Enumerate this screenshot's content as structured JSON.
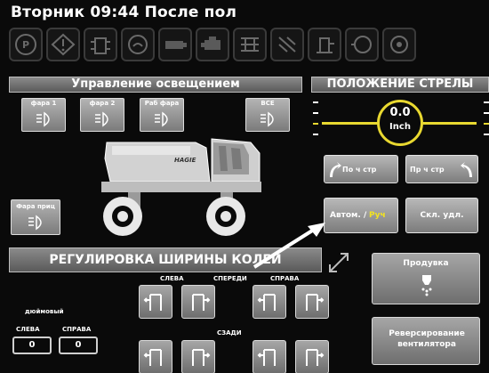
{
  "header": {
    "title": "Вторник 09:44 После пол"
  },
  "warning_icons": [
    "parking-brake-icon",
    "warning-triangle-icon",
    "fuel-filter-icon",
    "coolant-icon",
    "oil-pressure-icon",
    "engine-icon",
    "transmission-icon",
    "hydraulic-icon",
    "oil-level-icon",
    "engine-check-icon",
    "filter-icon"
  ],
  "lighting": {
    "title": "Управление освещением",
    "buttons": [
      {
        "label": "фара 1"
      },
      {
        "label": "фара 2"
      },
      {
        "label": "Раб фара"
      },
      {
        "label": "ВСЕ"
      },
      {
        "label": "Фара приц"
      }
    ],
    "vehicle_brand": "HAGIE"
  },
  "boom": {
    "title": "ПОЛОЖЕНИЕ СТРЕЛЫ",
    "value": "0.0",
    "unit": "Inch",
    "buttons": {
      "left": "По ч стр",
      "right": "Пр ч стр",
      "auto": "Автом. /",
      "manual": "Руч",
      "collapse": "Скл. удл."
    }
  },
  "track_width": {
    "title": "РЕГУЛИРОВКА ШИРИНЫ КОЛЕИ",
    "front_label": "СПЕРЕДИ",
    "rear_label": "СЗАДИ",
    "left_label": "СЛЕВА",
    "right_label": "СПРАВА",
    "units_label": "дюймовый",
    "readout_left_label": "СЛЕВА",
    "readout_right_label": "СПРАВА",
    "readout_left": "0",
    "readout_right": "0"
  },
  "right_panel": {
    "blowout_label": "Продувка",
    "fan_reverse_label": "Реверсирование вентилятора"
  }
}
